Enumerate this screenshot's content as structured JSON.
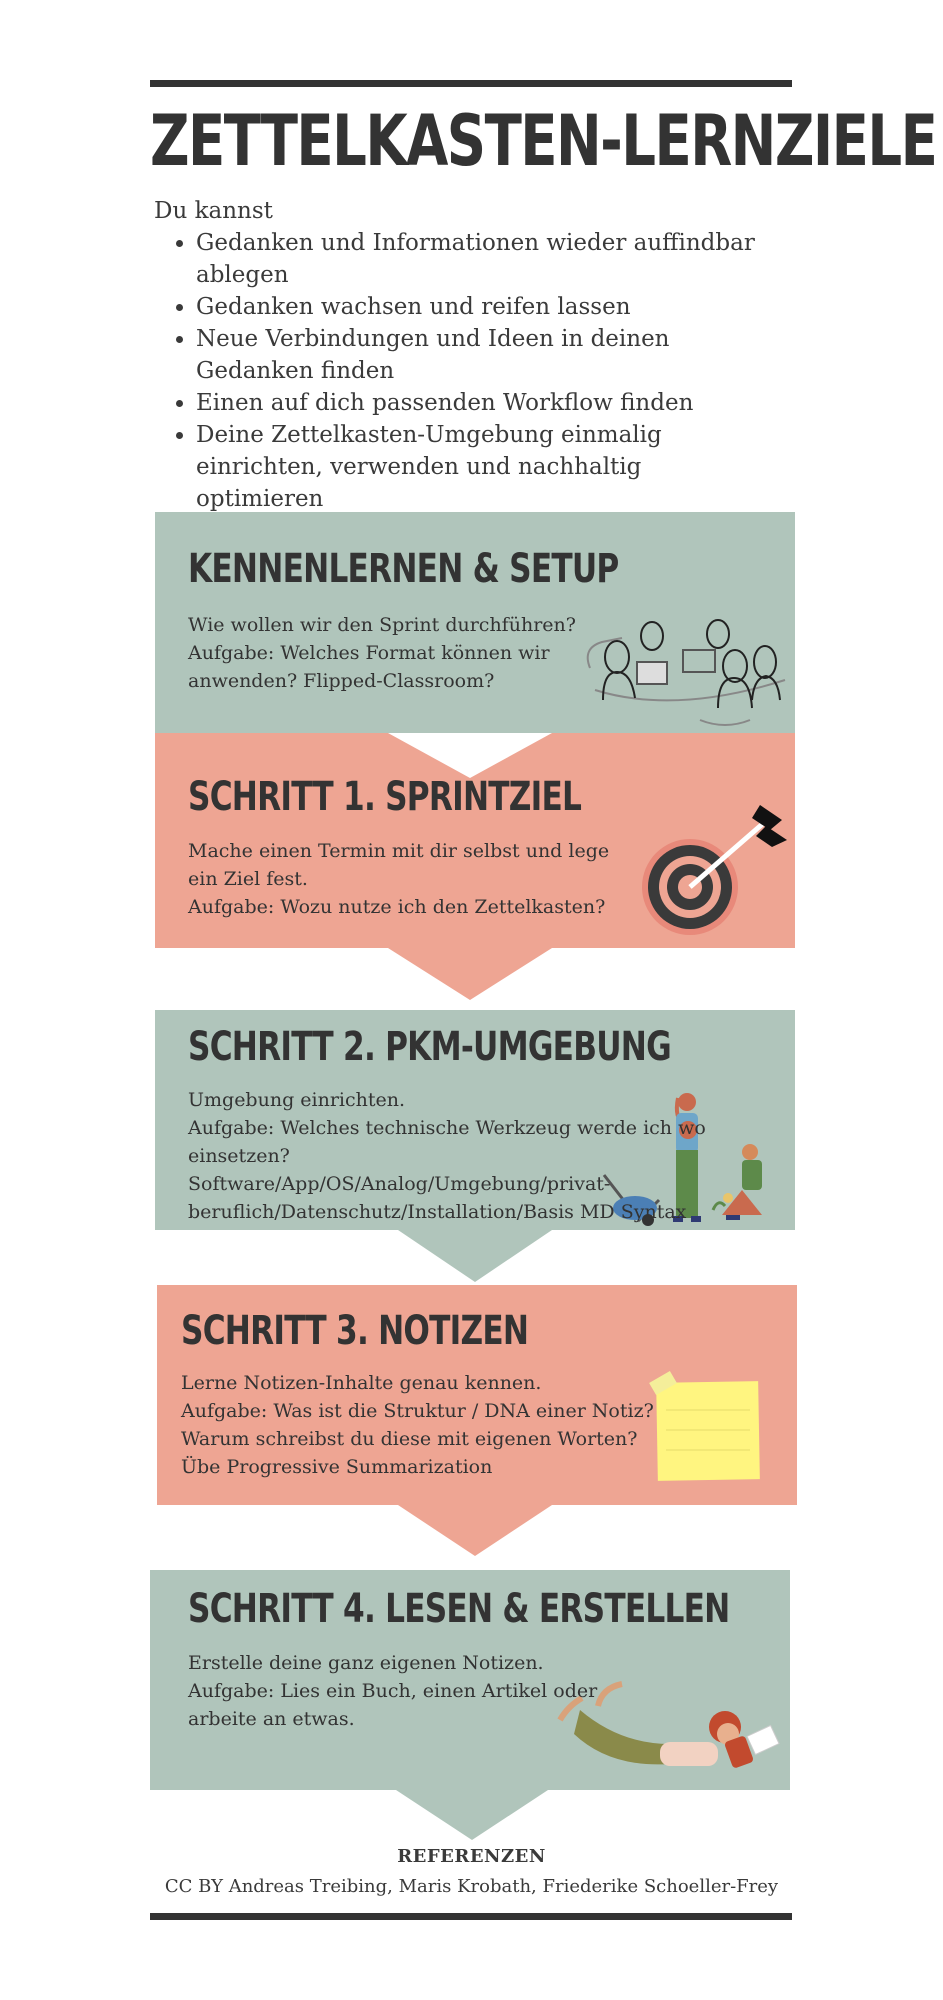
{
  "header": {
    "title": "ZETTELKASTEN-LERNZIELE",
    "intro": "Du kannst",
    "goals": [
      "Gedanken und Informationen wieder auffindbar ablegen",
      "Gedanken wachsen und reifen lassen",
      "Neue Verbindungen und Ideen in deinen Gedanken finden",
      "Einen auf dich passenden Workflow finden",
      "Deine Zettelkasten-Umgebung einmalig einrichten, verwenden und nachhaltig optimieren"
    ]
  },
  "sections": [
    {
      "title": "KENNENLERNEN & SETUP",
      "lines": [
        "Wie wollen wir den Sprint durchführen?",
        "Aufgabe: Welches Format können wir",
        "anwenden? Flipped-Classroom?"
      ],
      "color": "#b0c5bb",
      "icon": "people-meeting-icon"
    },
    {
      "title": "SCHRITT 1. SPRINTZIEL",
      "lines": [
        "Mache einen Termin mit dir selbst und lege",
        "ein Ziel fest.",
        "Aufgabe: Wozu nutze ich den Zettelkasten?"
      ],
      "color": "#eea593",
      "icon": "target-arrow-icon"
    },
    {
      "title": "SCHRITT 2. PKM-UMGEBUNG",
      "lines": [
        "Umgebung einrichten.",
        "Aufgabe: Welches technische Werkzeug werde ich wo",
        "einsetzen?",
        "Software/App/OS/Analog/Umgebung/privat-",
        "beruflich/Datenschutz/Installation/Basis MD Syntax"
      ],
      "color": "#b0c5bb",
      "icon": "gardeners-icon"
    },
    {
      "title": "SCHRITT 3. NOTIZEN",
      "lines": [
        "Lerne Notizen-Inhalte genau kennen.",
        "Aufgabe: Was ist die Struktur / DNA einer Notiz?",
        "Warum schreibst du diese mit eigenen Worten?",
        "Übe Progressive Summarization"
      ],
      "color": "#eea593",
      "icon": "sticky-note-icon"
    },
    {
      "title": "SCHRITT 4. LESEN & ERSTELLEN",
      "lines": [
        "Erstelle deine ganz eigenen Notizen.",
        "Aufgabe: Lies ein Buch, einen Artikel oder",
        "arbeite an etwas."
      ],
      "color": "#b0c5bb",
      "icon": "reading-person-icon"
    }
  ],
  "references": {
    "heading": "REFERENZEN",
    "text": "CC BY Andreas Treibing, Maris Krobath, Friederike Schoeller-Frey"
  }
}
